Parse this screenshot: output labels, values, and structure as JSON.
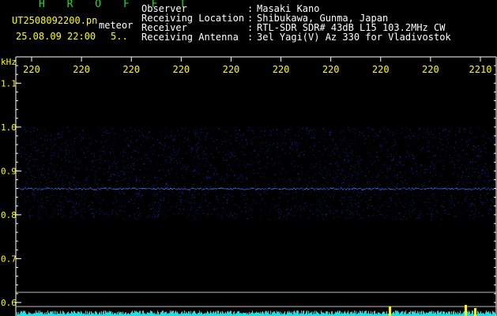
{
  "header": {
    "station_code": "H R O F F T",
    "filename": "UT2508092200.pn",
    "meteor_label": "meteor",
    "datetime": "25.08.09 22:00",
    "count": "5..",
    "fields": [
      {
        "key": "Observer",
        "value": "Masaki Kano"
      },
      {
        "key": "Receiving Location",
        "value": "Shibukawa, Gunma, Japan"
      },
      {
        "key": "Receiver",
        "value": "RTL-SDR SDR# 43dB L15 103.2MHz CW"
      },
      {
        "key": "Receiving Antenna",
        "value": "3el Yagi(V) Az 330 for Vladivostok"
      }
    ],
    "separator": ":"
  },
  "chart_data": {
    "type": "heatmap",
    "ylabel": "kHz",
    "yticks": [
      "1.1",
      "1.0",
      "0.9",
      "0.8",
      "0.7",
      "0.6"
    ],
    "ylim": [
      0.58,
      1.16
    ],
    "xticks": [
      "220",
      "220",
      "220",
      "220",
      "220",
      "220",
      "220",
      "220",
      "220",
      "2210"
    ],
    "signal_band_khz": [
      0.79,
      1.0
    ],
    "bright_line_khz": 0.86,
    "grid": false,
    "colors": {
      "background": "#000000",
      "axis": "#ffffff",
      "ticklabel": "#ffff00",
      "signal": "#2233ff",
      "signal_bright": "#5577ff",
      "meter": "#22dddd",
      "meter_hot": "#ffff00"
    }
  }
}
